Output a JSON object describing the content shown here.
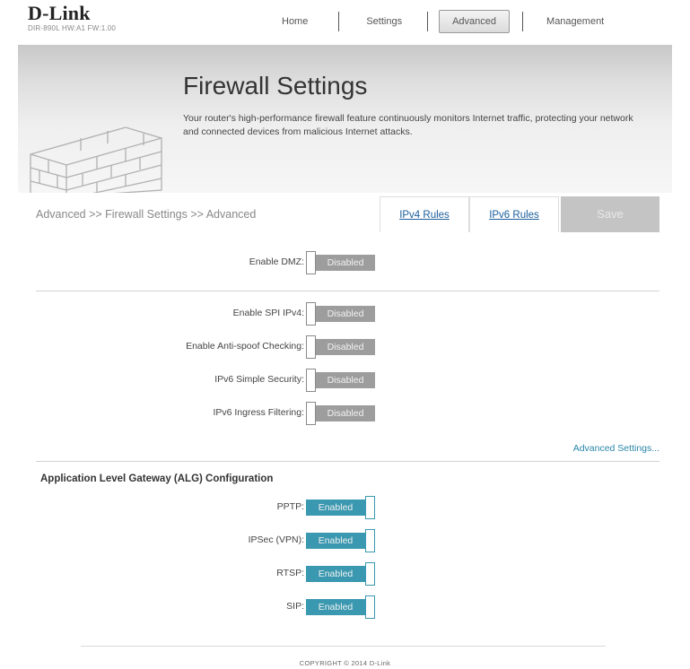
{
  "brand": {
    "name": "D-Link",
    "model_info": "DIR-890L  HW:A1  FW:1.00"
  },
  "nav": {
    "home": "Home",
    "settings": "Settings",
    "advanced": "Advanced",
    "management": "Management"
  },
  "hero": {
    "title": "Firewall Settings",
    "description": "Your router's high-performance firewall feature continuously monitors Internet traffic, protecting your network and connected devices from malicious Internet attacks."
  },
  "breadcrumb": "Advanced >> Firewall Settings >> Advanced",
  "tabs": {
    "ipv4": "IPv4 Rules",
    "ipv6": "IPv6 Rules",
    "save": "Save"
  },
  "dmz": {
    "label": "Enable DMZ:",
    "state": "Disabled"
  },
  "firewall_options": [
    {
      "label": "Enable SPI IPv4:",
      "state": "Disabled"
    },
    {
      "label": "Enable Anti-spoof Checking:",
      "state": "Disabled"
    },
    {
      "label": "IPv6 Simple Security:",
      "state": "Disabled"
    },
    {
      "label": "IPv6 Ingress Filtering:",
      "state": "Disabled"
    }
  ],
  "advanced_settings_link": "Advanced Settings...",
  "alg": {
    "title": "Application Level Gateway (ALG) Configuration",
    "items": [
      {
        "label": "PPTP:",
        "state": "Enabled"
      },
      {
        "label": "IPSec (VPN):",
        "state": "Enabled"
      },
      {
        "label": "RTSP:",
        "state": "Enabled"
      },
      {
        "label": "SIP:",
        "state": "Enabled"
      }
    ]
  },
  "footer": "COPYRIGHT © 2014 D-Link",
  "colors": {
    "enabled": "#3a98b0",
    "disabled": "#9d9d9d",
    "link": "#1b5e9b"
  }
}
